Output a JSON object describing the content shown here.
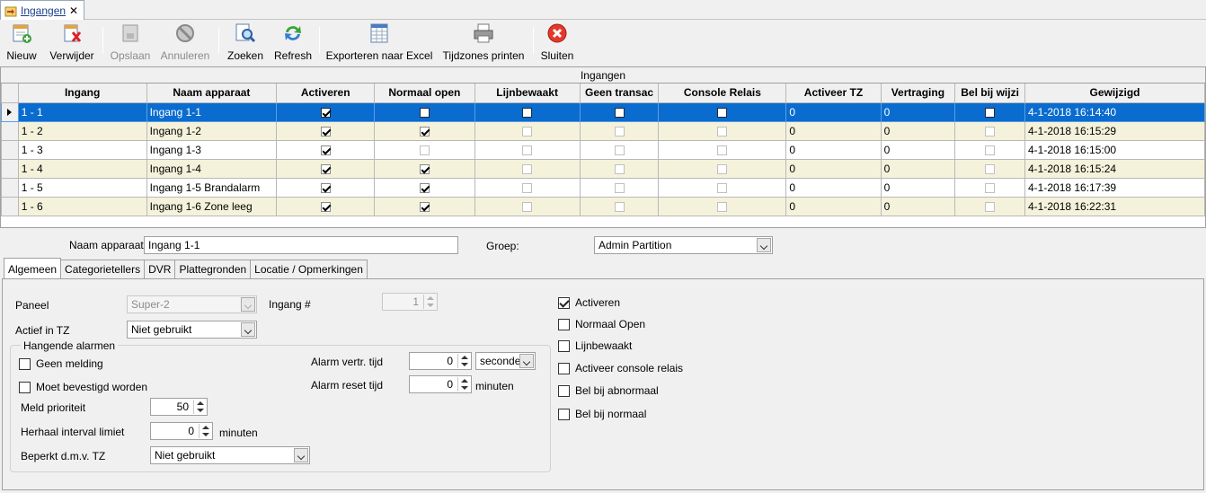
{
  "doc_tab": {
    "label": "Ingangen",
    "icon": "entrance-icon",
    "close": "✕"
  },
  "toolbar": {
    "nieuw": "Nieuw",
    "verwijder": "Verwijder",
    "opslaan": "Opslaan",
    "annuleren": "Annuleren",
    "zoeken": "Zoeken",
    "refresh": "Refresh",
    "exporteren": "Exporteren naar Excel",
    "tijdzones": "Tijdzones printen",
    "sluiten": "Sluiten"
  },
  "grid": {
    "title": "Ingangen",
    "columns": [
      "Ingang",
      "Naam apparaat",
      "Activeren",
      "Normaal open",
      "Lijnbewaakt",
      "Geen transac",
      "Console Relais",
      "Activeer TZ",
      "Vertraging",
      "Bel bij wijzi",
      "Gewijzigd"
    ],
    "rows": [
      {
        "ingang": "1 - 1",
        "naam": "Ingang 1-1",
        "activeren": true,
        "normaal_open": false,
        "lijnbewaakt": false,
        "geen_transac": false,
        "console_relais": false,
        "activeer_tz": "0",
        "vertraging": "0",
        "bel": false,
        "gewijzigd": "4-1-2018 16:14:40"
      },
      {
        "ingang": "1 - 2",
        "naam": "Ingang 1-2",
        "activeren": true,
        "normaal_open": true,
        "lijnbewaakt": false,
        "geen_transac": false,
        "console_relais": false,
        "activeer_tz": "0",
        "vertraging": "0",
        "bel": false,
        "gewijzigd": "4-1-2018 16:15:29"
      },
      {
        "ingang": "1 - 3",
        "naam": "Ingang 1-3",
        "activeren": true,
        "normaal_open": false,
        "lijnbewaakt": false,
        "geen_transac": false,
        "console_relais": false,
        "activeer_tz": "0",
        "vertraging": "0",
        "bel": false,
        "gewijzigd": "4-1-2018 16:15:00"
      },
      {
        "ingang": "1 - 4",
        "naam": "Ingang 1-4",
        "activeren": true,
        "normaal_open": true,
        "lijnbewaakt": false,
        "geen_transac": false,
        "console_relais": false,
        "activeer_tz": "0",
        "vertraging": "0",
        "bel": false,
        "gewijzigd": "4-1-2018 16:15:24"
      },
      {
        "ingang": "1 - 5",
        "naam": "Ingang 1-5 Brandalarm",
        "activeren": true,
        "normaal_open": true,
        "lijnbewaakt": false,
        "geen_transac": false,
        "console_relais": false,
        "activeer_tz": "0",
        "vertraging": "0",
        "bel": false,
        "gewijzigd": "4-1-2018 16:17:39"
      },
      {
        "ingang": "1 - 6",
        "naam": "Ingang 1-6 Zone leeg",
        "activeren": true,
        "normaal_open": true,
        "lijnbewaakt": false,
        "geen_transac": false,
        "console_relais": false,
        "activeer_tz": "0",
        "vertraging": "0",
        "bel": false,
        "gewijzigd": "4-1-2018 16:22:31"
      }
    ]
  },
  "detail": {
    "naam_label": "Naam apparaat",
    "naam_value": "Ingang 1-1",
    "groep_label": "Groep:",
    "groep_value": "Admin Partition"
  },
  "tabs": [
    "Algemeen",
    "Categorietellers",
    "DVR",
    "Plattegronden",
    "Locatie / Opmerkingen"
  ],
  "algemeen": {
    "paneel_label": "Paneel",
    "paneel_value": "Super-2",
    "ingang_nr_label": "Ingang #",
    "ingang_nr_value": "1",
    "actief_tz_label": "Actief in TZ",
    "actief_tz_value": "Niet gebruikt",
    "hangende_alarmen": "Hangende alarmen",
    "geen_melding": "Geen melding",
    "moet_bevestigd": "Moet bevestigd worden",
    "meld_prioriteit_label": "Meld prioriteit",
    "meld_prioriteit_value": "50",
    "herhaal_label": "Herhaal interval limiet",
    "herhaal_value": "0",
    "herhaal_unit": "minuten",
    "beperkt_label": "Beperkt d.m.v. TZ",
    "beperkt_value": "Niet gebruikt",
    "alarm_vertr_label": "Alarm vertr. tijd",
    "alarm_vertr_value": "0",
    "alarm_vertr_unit": "seconde",
    "alarm_reset_label": "Alarm reset tijd",
    "alarm_reset_value": "0",
    "alarm_reset_unit": "minuten",
    "checkboxes": [
      {
        "label": "Activeren",
        "checked": true
      },
      {
        "label": "Normaal Open",
        "checked": false
      },
      {
        "label": "Lijnbewaakt",
        "checked": false
      },
      {
        "label": "Activeer console relais",
        "checked": false
      },
      {
        "label": "Bel bij abnormaal",
        "checked": false
      },
      {
        "label": "Bel bij normaal",
        "checked": false
      }
    ]
  },
  "colors": {
    "selection": "#0a6ccf",
    "alt_row": "#f5f2dc",
    "window_bg": "#f0f0f0"
  }
}
